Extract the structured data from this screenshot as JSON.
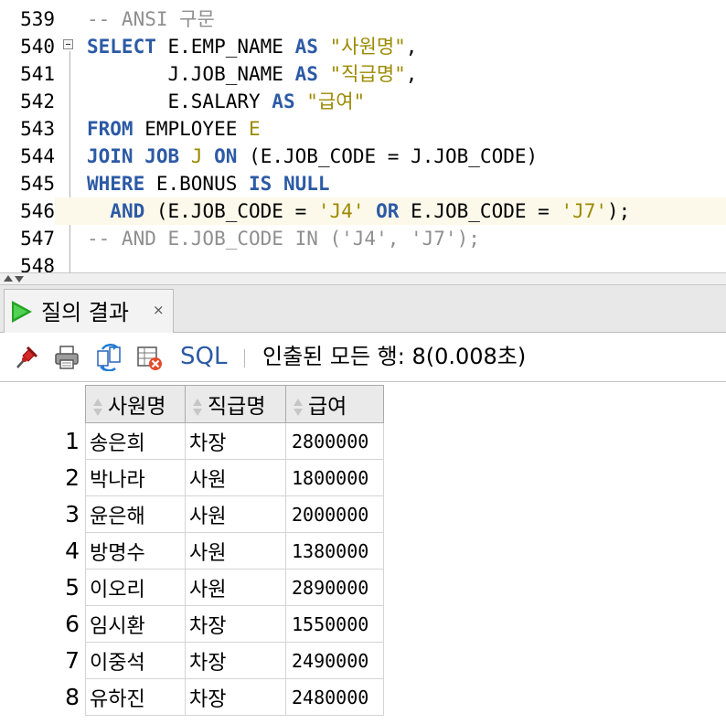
{
  "editor": {
    "lines": [
      {
        "num": "539",
        "tokens": [
          {
            "t": "-- ANSI 구문",
            "c": "cmt"
          }
        ]
      },
      {
        "num": "540",
        "tokens": [
          {
            "t": "SELECT",
            "c": "kw"
          },
          {
            "t": " E.EMP_NAME ",
            "c": ""
          },
          {
            "t": "AS",
            "c": "kw"
          },
          {
            "t": " ",
            "c": ""
          },
          {
            "t": "\"사원명\"",
            "c": "str"
          },
          {
            "t": ",",
            "c": ""
          }
        ]
      },
      {
        "num": "541",
        "tokens": [
          {
            "t": "       J.JOB_NAME ",
            "c": ""
          },
          {
            "t": "AS",
            "c": "kw"
          },
          {
            "t": " ",
            "c": ""
          },
          {
            "t": "\"직급명\"",
            "c": "str"
          },
          {
            "t": ",",
            "c": ""
          }
        ]
      },
      {
        "num": "542",
        "tokens": [
          {
            "t": "       E.SALARY ",
            "c": ""
          },
          {
            "t": "AS",
            "c": "kw"
          },
          {
            "t": " ",
            "c": ""
          },
          {
            "t": "\"급여\"",
            "c": "str"
          }
        ]
      },
      {
        "num": "543",
        "tokens": [
          {
            "t": "FROM",
            "c": "kw"
          },
          {
            "t": " EMPLOYEE ",
            "c": ""
          },
          {
            "t": "E",
            "c": "alias"
          }
        ]
      },
      {
        "num": "544",
        "tokens": [
          {
            "t": "JOIN",
            "c": "kw"
          },
          {
            "t": " ",
            "c": ""
          },
          {
            "t": "JOB",
            "c": "kw"
          },
          {
            "t": " ",
            "c": ""
          },
          {
            "t": "J",
            "c": "alias"
          },
          {
            "t": " ",
            "c": ""
          },
          {
            "t": "ON",
            "c": "kw"
          },
          {
            "t": " (E.JOB_CODE = J.JOB_CODE)",
            "c": ""
          }
        ]
      },
      {
        "num": "545",
        "tokens": [
          {
            "t": "WHERE",
            "c": "kw"
          },
          {
            "t": " E.BONUS ",
            "c": ""
          },
          {
            "t": "IS",
            "c": "kw"
          },
          {
            "t": " ",
            "c": ""
          },
          {
            "t": "NULL",
            "c": "kw"
          }
        ]
      },
      {
        "num": "546",
        "highlight": true,
        "tokens": [
          {
            "t": "  ",
            "c": ""
          },
          {
            "t": "AND",
            "c": "kw"
          },
          {
            "t": " (E.JOB_CODE = ",
            "c": ""
          },
          {
            "t": "'J4'",
            "c": "str"
          },
          {
            "t": " ",
            "c": ""
          },
          {
            "t": "OR",
            "c": "kw"
          },
          {
            "t": " E.JOB_CODE = ",
            "c": ""
          },
          {
            "t": "'J7'",
            "c": "str"
          },
          {
            "t": ");",
            "c": ""
          }
        ]
      },
      {
        "num": "547",
        "tokens": [
          {
            "t": "-- AND E.JOB_CODE IN ('J4', 'J7');",
            "c": "cmt"
          }
        ]
      },
      {
        "num": "548",
        "tokens": []
      }
    ]
  },
  "results_tab": {
    "label": "질의 결과",
    "close": "×",
    "icon": "play-icon",
    "accent": "#26a326"
  },
  "toolbar": {
    "icons": [
      "pin-icon",
      "print-icon",
      "refresh-icon",
      "cancel-query-icon"
    ],
    "sql_label": "SQL",
    "status": "인출된 모든 행: 8(0.008초)",
    "link_color": "#2c5aa5"
  },
  "grid": {
    "columns": [
      "사원명",
      "직급명",
      "급여"
    ],
    "rows": [
      {
        "n": "1",
        "name": "송은희",
        "job": "차장",
        "salary": "2800000"
      },
      {
        "n": "2",
        "name": "박나라",
        "job": "사원",
        "salary": "1800000"
      },
      {
        "n": "3",
        "name": "윤은해",
        "job": "사원",
        "salary": "2000000"
      },
      {
        "n": "4",
        "name": "방명수",
        "job": "사원",
        "salary": "1380000"
      },
      {
        "n": "5",
        "name": "이오리",
        "job": "사원",
        "salary": "2890000"
      },
      {
        "n": "6",
        "name": "임시환",
        "job": "차장",
        "salary": "1550000"
      },
      {
        "n": "7",
        "name": "이중석",
        "job": "차장",
        "salary": "2490000"
      },
      {
        "n": "8",
        "name": "유하진",
        "job": "차장",
        "salary": "2480000"
      }
    ]
  }
}
